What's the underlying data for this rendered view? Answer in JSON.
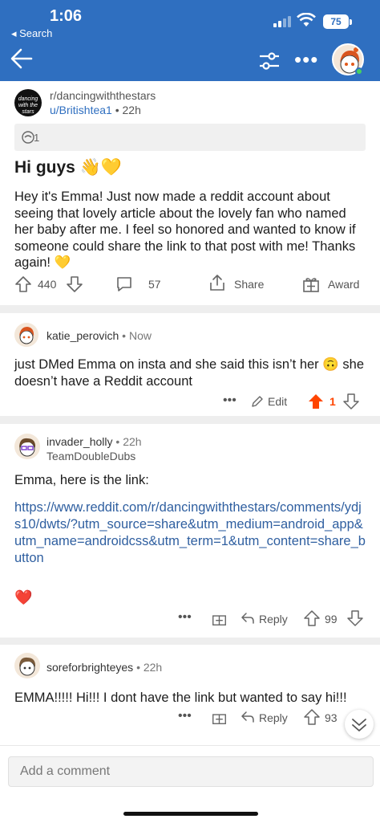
{
  "status": {
    "time": "1:06",
    "back_app": "◂ Search",
    "battery": "75"
  },
  "post": {
    "subreddit": "r/dancingwiththestars",
    "subreddit_logo_text": "dancing with the stars",
    "author": "u/Britishtea1",
    "age": "22h",
    "award_count": "1",
    "title": "Hi guys 👋💛",
    "body": "Hey it's Emma! Just now made a reddit account about seeing that lovely article about the lovely fan who named her baby after me. I feel so honored and wanted to know if someone could share the link to that post with me! Thanks again! 💛",
    "votes": "440",
    "comments": "57",
    "share_label": "Share",
    "award_label": "Award"
  },
  "comments": [
    {
      "username": "katie_perovich",
      "age": "Now",
      "body": "just DMed Emma on insta and she said this isn’t her 🙃 she doesn’t have a Reddit account",
      "edit_label": "Edit",
      "votes": "1",
      "upvoted": true,
      "accent": "#ff4500"
    },
    {
      "username": "invader_holly",
      "age": "22h",
      "flair": "TeamDoubleDubs",
      "intro": "Emma, here is the link:",
      "link": "https://www.reddit.com/r/dancingwiththestars/comments/ydjs10/dwts/?utm_source=share&utm_medium=android_app&utm_name=androidcss&utm_term=1&utm_content=share_button",
      "emoji": "❤️",
      "reply_label": "Reply",
      "votes": "99"
    },
    {
      "username": "soreforbrighteyes",
      "age": "22h",
      "body": "EMMA!!!!! Hi!!! I dont have the link but wanted to say hi!!!",
      "reply_label": "Reply",
      "votes": "93"
    }
  ],
  "comment_bar": {
    "placeholder": "Add a comment"
  },
  "colors": {
    "header_blue": "#2f6fc0",
    "link_blue": "#2f5fa0",
    "upvote_orange": "#ff4500"
  }
}
